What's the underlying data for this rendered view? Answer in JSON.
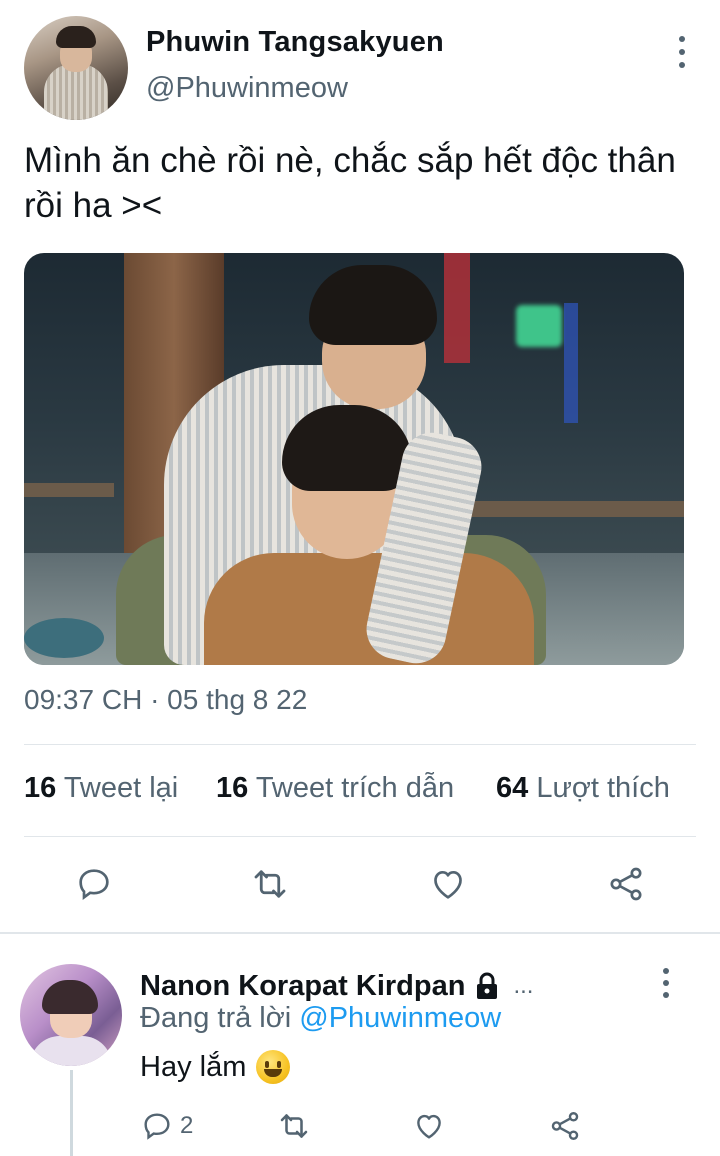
{
  "tweet": {
    "author_name": "Phuwin Tangsakyuen",
    "author_handle": "@Phuwinmeow",
    "text": "Mình ăn chè rồi nè, chắc sắp hết độc thân rồi ha ><",
    "timestamp": "09:37 CH · 05 thg 8 22",
    "stats": {
      "retweets_count": "16",
      "retweets_label": "Tweet lại",
      "quotes_count": "16",
      "quotes_label": "Tweet trích dẫn",
      "likes_count": "64",
      "likes_label": "Lượt thích"
    },
    "actions": [
      "reply-icon",
      "retweet-icon",
      "like-icon",
      "share-icon"
    ]
  },
  "reply": {
    "author_name": "Nanon Korapat Kirdpan",
    "ellipsis": "...",
    "replying_prefix": "Đang trả lời",
    "replying_mention": "@Phuwinmeow",
    "text": "Hay lắm",
    "reply_count": "2"
  },
  "colors": {
    "text_primary": "#0f1419",
    "text_secondary": "#536471",
    "accent": "#1d9bf0",
    "divider": "#e1e6ea"
  }
}
